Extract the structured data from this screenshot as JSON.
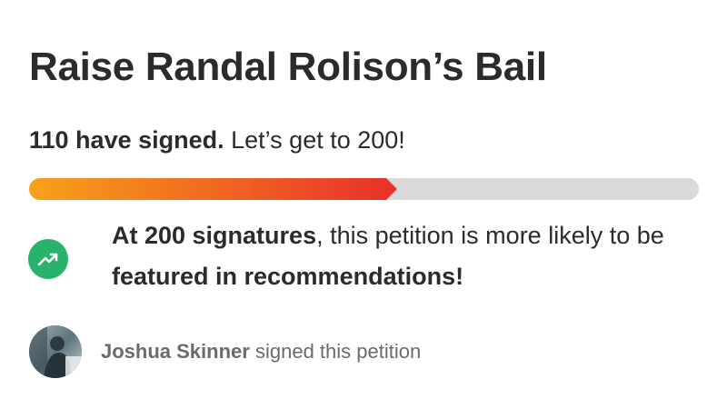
{
  "petition": {
    "title": "Raise Randal Rolison’s Bail"
  },
  "signatures": {
    "signed_text": "110 have signed.",
    "goal_text": "Let’s get to 200!",
    "signed_count": 110,
    "goal_count": 200,
    "progress_fraction": 0.55,
    "progress_colors": {
      "start": "#f7a11a",
      "end": "#e8322b",
      "track": "#dadada"
    }
  },
  "milestone": {
    "icon": "trending-up-icon",
    "icon_color": "#27b36c",
    "bold_1": "At 200 signatures",
    "text_1": ", this petition is more likely to be ",
    "bold_2": "featured in recommendations!"
  },
  "recent_signer": {
    "name": "Joshua Skinner",
    "action_text": "signed this petition",
    "avatar": "user-avatar-photo"
  }
}
